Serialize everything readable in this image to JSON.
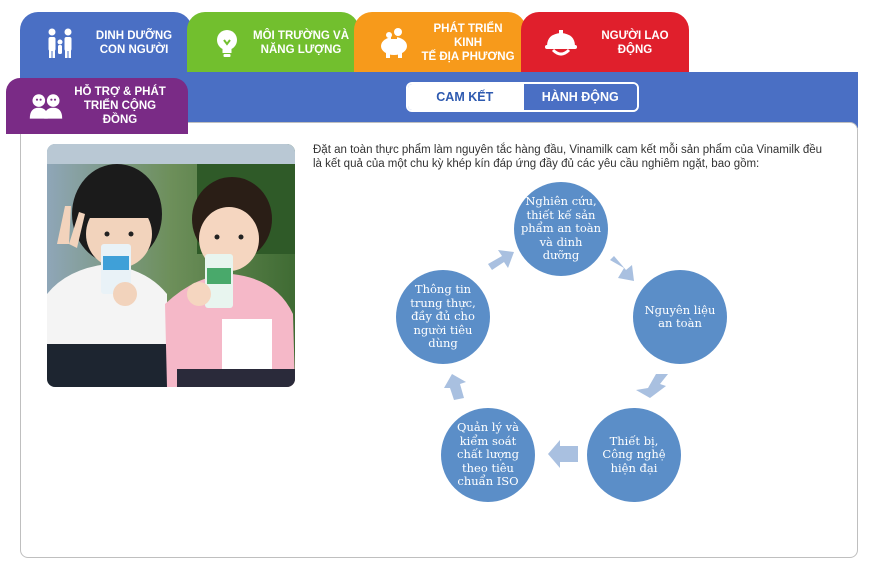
{
  "tabs": [
    {
      "label_line1": "DINH DƯỠNG",
      "label_line2": "CON NGƯỜI",
      "icon": "family-icon",
      "color": "#4a6fc4"
    },
    {
      "label_line1": "MÔI TRƯỜNG VÀ",
      "label_line2": "NĂNG LƯỢNG",
      "icon": "lightbulb-icon",
      "color": "#72bf2e"
    },
    {
      "label_line1": "PHÁT TRIỂN KINH",
      "label_line2": "TẾ ĐỊA PHƯƠNG",
      "icon": "piggy-bank-icon",
      "color": "#f79a1b"
    },
    {
      "label_line1": "NGƯỜI LAO",
      "label_line2": "ĐỘNG",
      "icon": "helmet-icon",
      "color": "#e01f2c"
    },
    {
      "label_line1": "HỖ TRỢ & PHÁT",
      "label_line2": "TRIỂN CỘNG ĐỒNG",
      "icon": "people-icon",
      "color": "#7a2b86"
    }
  ],
  "subtabs": {
    "commit": "CAM KẾT",
    "action": "HÀNH ĐỘNG"
  },
  "content": {
    "intro": "Đặt an toàn thực phẩm làm nguyên tắc hàng đầu, Vinamilk cam kết mỗi sản phẩm của Vinamilk đều là kết quả của một chu kỳ khép kín đáp ứng đầy đủ các yêu cầu nghiêm ngặt, bao gồm:",
    "cycle": [
      "Nghiên cứu, thiết kế sản phẩm an toàn và dinh dưỡng",
      "Nguyên liệu an toàn",
      "Thiết bị, Công nghệ hiện đại",
      "Quản lý và kiểm soát chất lượng theo tiêu chuẩn ISO",
      "Thông tin trung thực, đầy đủ cho người tiêu dùng"
    ]
  },
  "colors": {
    "node": "#5b8ec8",
    "arrow": "#a9c0e0"
  }
}
